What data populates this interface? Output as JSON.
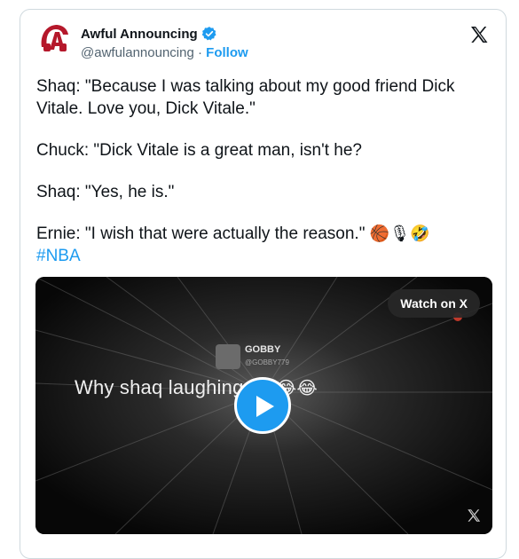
{
  "author": {
    "name": "Awful Announcing",
    "handle": "@awfulannouncing",
    "separator": "·",
    "follow_label": "Follow"
  },
  "tweet": {
    "paragraphs": [
      "Shaq: \"Because I was talking about my good friend Dick Vitale. Love you, Dick Vitale.\"",
      "Chuck: \"Dick Vitale is a great man, isn't he?",
      "Shaq: \"Yes, he is.\"",
      "Ernie: \"I wish that were actually the reason.\""
    ],
    "emojis": "🏀🎙🤣",
    "hashtag": "#NBA"
  },
  "video": {
    "watch_label": "Watch on X",
    "channel_name": "GOBBY",
    "channel_handle": "@GOBBY779",
    "caption": "Why shaq laughing so",
    "caption_emojis": "😂😂"
  },
  "colors": {
    "accent": "#1d9bf0",
    "text": "#0f1419",
    "secondary": "#536471",
    "brand_red": "#b5182b"
  },
  "icons": [
    "awful-announcing-logo",
    "verified-badge-icon",
    "x-logo-icon",
    "play-icon"
  ]
}
